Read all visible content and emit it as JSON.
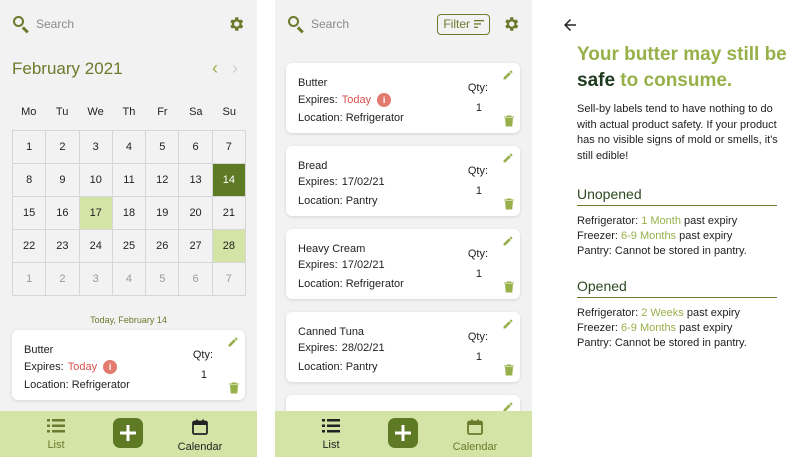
{
  "colors": {
    "accent": "#6b7a2c",
    "accent_light": "#d4e3a6",
    "today_cell": "#5f7a25",
    "alert": "#d9534f",
    "headline": "#98b04a"
  },
  "search": {
    "placeholder": "Search",
    "filter_label": "Filter"
  },
  "calendar": {
    "month_title": "February 2021",
    "weekdays": [
      "Mo",
      "Tu",
      "We",
      "Th",
      "Fr",
      "Sa",
      "Su"
    ],
    "cells": [
      {
        "d": "1",
        "s": ""
      },
      {
        "d": "2",
        "s": ""
      },
      {
        "d": "3",
        "s": ""
      },
      {
        "d": "4",
        "s": ""
      },
      {
        "d": "5",
        "s": ""
      },
      {
        "d": "6",
        "s": ""
      },
      {
        "d": "7",
        "s": ""
      },
      {
        "d": "8",
        "s": ""
      },
      {
        "d": "9",
        "s": ""
      },
      {
        "d": "10",
        "s": ""
      },
      {
        "d": "11",
        "s": ""
      },
      {
        "d": "12",
        "s": ""
      },
      {
        "d": "13",
        "s": ""
      },
      {
        "d": "14",
        "s": "today"
      },
      {
        "d": "15",
        "s": ""
      },
      {
        "d": "16",
        "s": ""
      },
      {
        "d": "17",
        "s": "highlight"
      },
      {
        "d": "18",
        "s": ""
      },
      {
        "d": "19",
        "s": ""
      },
      {
        "d": "20",
        "s": ""
      },
      {
        "d": "21",
        "s": ""
      },
      {
        "d": "22",
        "s": ""
      },
      {
        "d": "23",
        "s": ""
      },
      {
        "d": "24",
        "s": ""
      },
      {
        "d": "25",
        "s": ""
      },
      {
        "d": "26",
        "s": ""
      },
      {
        "d": "27",
        "s": ""
      },
      {
        "d": "28",
        "s": "highlight"
      },
      {
        "d": "1",
        "s": "muted"
      },
      {
        "d": "2",
        "s": "muted"
      },
      {
        "d": "3",
        "s": "muted"
      },
      {
        "d": "4",
        "s": "muted"
      },
      {
        "d": "5",
        "s": "muted"
      },
      {
        "d": "6",
        "s": "muted"
      },
      {
        "d": "7",
        "s": "muted"
      }
    ],
    "today_label": "Today, February 14"
  },
  "qty_label": "Qty:",
  "calendar_item": {
    "name": "Butter",
    "expires_label": "Expires:",
    "expires_value": "Today",
    "location": "Location: Refrigerator",
    "qty": "1"
  },
  "list_items": [
    {
      "name": "Butter",
      "expires_label": "Expires:",
      "expires_value": "Today",
      "location": "Location: Refrigerator",
      "qty": "1"
    },
    {
      "name": "Bread",
      "expires_label": "Expires:",
      "expires_value": "17/02/21",
      "location": "Location: Pantry",
      "qty": "1"
    },
    {
      "name": "Heavy Cream",
      "expires_label": "Expires:",
      "expires_value": "17/02/21",
      "location": "Location: Refrigerator",
      "qty": "1"
    },
    {
      "name": "Canned Tuna",
      "expires_label": "Expires:",
      "expires_value": "28/02/21",
      "location": "Location: Pantry",
      "qty": "1"
    }
  ],
  "nav": {
    "list": "List",
    "calendar": "Calendar"
  },
  "info": {
    "headline_part1": "Your butter may still be ",
    "headline_safe": "safe",
    "headline_part2": " to consume.",
    "intro": "Sell-by labels tend to have nothing to do with actual product safety. If your product has no visible signs of mold or smells, it's still edible!",
    "unopened": {
      "title": "Unopened",
      "refrigerator_label": "Refrigerator:",
      "refrigerator_value": "1 Month",
      "refrigerator_suffix": "past expiry",
      "freezer_label": "Freezer:",
      "freezer_value": "6-9 Months",
      "freezer_suffix": "past expiry",
      "pantry": "Pantry: Cannot be stored in pantry."
    },
    "opened": {
      "title": "Opened",
      "refrigerator_label": "Refrigerator:",
      "refrigerator_value": "2 Weeks",
      "refrigerator_suffix": "past expiry",
      "freezer_label": "Freezer:",
      "freezer_value": "6-9 Months",
      "freezer_suffix": "past expiry",
      "pantry": "Pantry: Cannot be stored in pantry."
    }
  }
}
